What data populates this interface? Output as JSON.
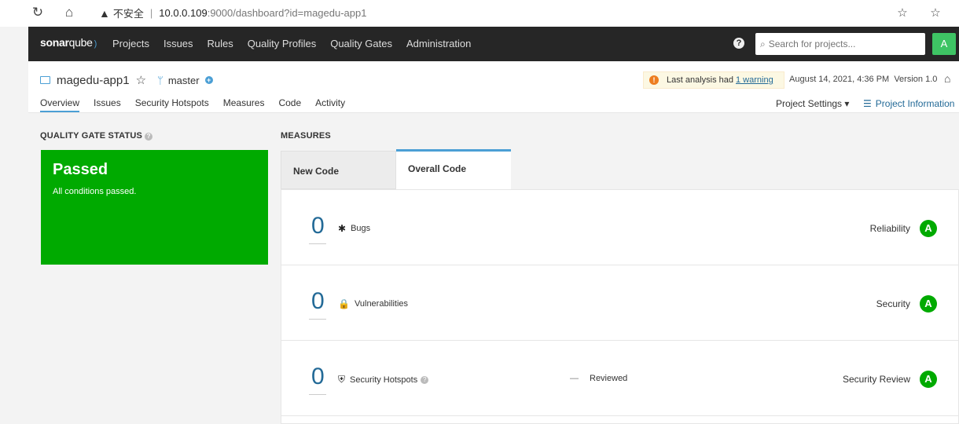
{
  "browser": {
    "back_icon": "reload-icon",
    "security_warning": "不安全",
    "url_host": "10.0.0.109",
    "url_rest": ":9000/dashboard?id=magedu-app1"
  },
  "nav": {
    "logo_bold": "sonar",
    "logo_rest": "qube",
    "items": [
      "Projects",
      "Issues",
      "Rules",
      "Quality Profiles",
      "Quality Gates",
      "Administration"
    ],
    "search_placeholder": "Search for projects...",
    "avatar_letter": "A"
  },
  "project": {
    "name": "magedu-app1",
    "branch": "master",
    "warning_prefix": "Last analysis had",
    "warning_link": "1 warning",
    "analysis_date": "August 14, 2021, 4:36 PM",
    "version": "Version 1.0",
    "tabs": [
      "Overview",
      "Issues",
      "Security Hotspots",
      "Measures",
      "Code",
      "Activity"
    ],
    "settings_label": "Project Settings ▾",
    "info_label": "Project Information"
  },
  "quality_gate": {
    "title": "QUALITY GATE STATUS",
    "status": "Passed",
    "description": "All conditions passed.",
    "color": "#00aa00"
  },
  "measures": {
    "title": "MEASURES",
    "tab_new": "New Code",
    "tab_overall": "Overall Code",
    "rows": [
      {
        "value": "0",
        "label": "Bugs",
        "icon": "bug-icon",
        "rating_label": "Reliability",
        "rating": "A"
      },
      {
        "value": "0",
        "label": "Vulnerabilities",
        "icon": "lock-icon",
        "rating_label": "Security",
        "rating": "A"
      },
      {
        "value": "0",
        "label": "Security Hotspots",
        "icon": "shield-icon",
        "reviewed_dash": "—",
        "reviewed_label": "Reviewed",
        "rating_label": "Security Review",
        "rating": "A"
      }
    ]
  }
}
